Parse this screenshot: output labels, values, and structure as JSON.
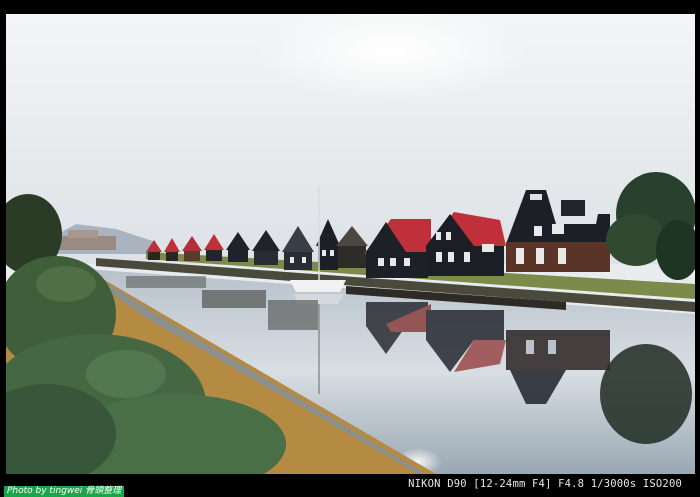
{
  "photo": {
    "subject": "canal-side row of gabled houses",
    "palette": {
      "sky": "#eef0f2",
      "water": "#c9d3db",
      "house_dark": "#1c1f26",
      "roof_red": "#c0303a",
      "grass": "#b58a43",
      "hedge": "#3f5f3a"
    }
  },
  "exif": {
    "text": "NIKON D90 [12-24mm F4] F4.8 1/3000s ISO200"
  },
  "credit": {
    "text": "Photo by tingwei 骨頭整理"
  }
}
